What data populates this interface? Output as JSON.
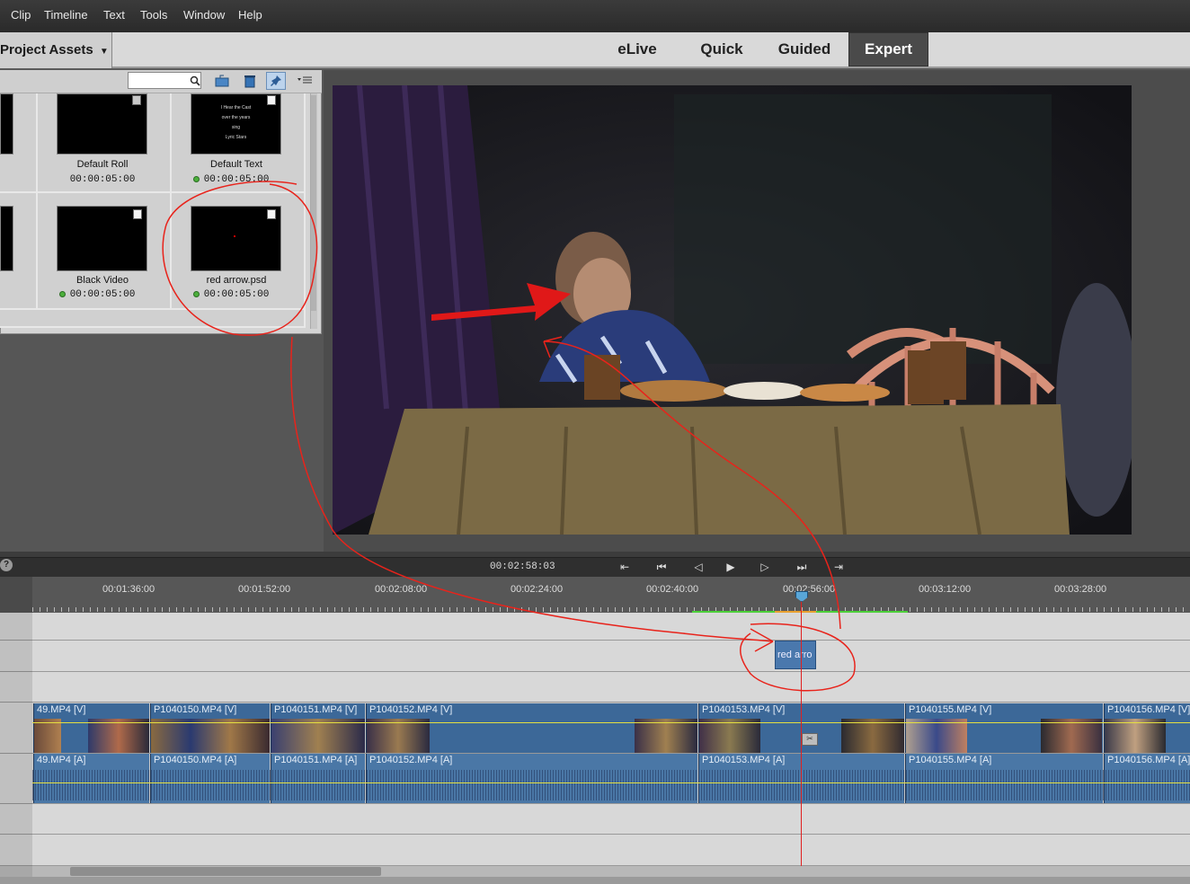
{
  "menu": [
    "Clip",
    "Timeline",
    "Text",
    "Tools",
    "Window",
    "Help"
  ],
  "assets_tab": "Project Assets",
  "modes": [
    "eLive",
    "Quick",
    "Guided",
    "Expert"
  ],
  "active_mode": "Expert",
  "search": {
    "placeholder": ""
  },
  "assets": [
    {
      "name": "Default Roll",
      "duration": "00:00:05:00"
    },
    {
      "name": "Default Text",
      "duration": "00:00:05:00"
    },
    {
      "name": "Black Video",
      "duration": "00:00:05:00"
    },
    {
      "name": "red arrow.psd",
      "duration": "00:00:05:00"
    }
  ],
  "text_thumb_lines": [
    "I Hear the Cast",
    "over the years",
    "sing",
    "Lyric Stars"
  ],
  "transport": {
    "timecode": "00:02:58:03"
  },
  "help": "?",
  "ruler_ticks": [
    "00:01:36:00",
    "00:01:52:00",
    "00:02:08:00",
    "00:02:24:00",
    "00:02:40:00",
    "00:02:56:00",
    "00:03:12:00",
    "00:03:28:00"
  ],
  "video_clips": [
    "49.MP4 [V]",
    "P1040150.MP4 [V]",
    "P1040151.MP4 [V]",
    "P1040152.MP4 [V]",
    "P1040153.MP4 [V]",
    "P1040155.MP4 [V]",
    "P1040156.MP4 [V]"
  ],
  "audio_clips": [
    "49.MP4 [A]",
    "P1040150.MP4 [A]",
    "P1040151.MP4 [A]",
    "P1040152.MP4 [A]",
    "P1040153.MP4 [A]",
    "P1040155.MP4 [A]",
    "P1040156.MP4 [A]"
  ],
  "overlay_clip": "red arro",
  "colors": {
    "annotation": "#e8231b",
    "clip_video": "#3c6898",
    "clip_audio": "#4a77a6",
    "playhead": "#e02020"
  }
}
